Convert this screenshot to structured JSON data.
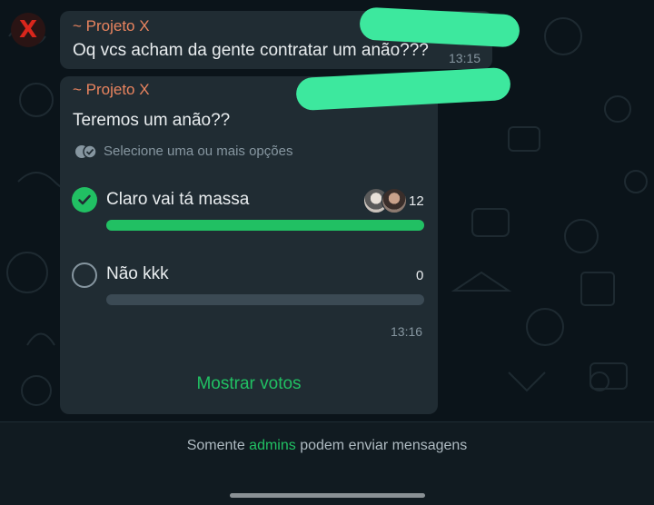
{
  "colors": {
    "accent": "#21c063",
    "sender": "#e9845f",
    "bubble": "#202c33",
    "background": "#0b141a",
    "redaction": "#3de89e"
  },
  "group_avatar": {
    "glyph": "X"
  },
  "messages": [
    {
      "sender": "~ Projeto X",
      "text": "Oq vcs acham da gente contratar um anão???",
      "time": "13:15"
    }
  ],
  "poll": {
    "sender": "~ Projeto X",
    "question": "Teremos um anão??",
    "hint": "Selecione uma ou mais opções",
    "hint_icon": "double-check-icon",
    "options": [
      {
        "label": "Claro vai tá massa",
        "votes": "12",
        "selected": true,
        "fraction": 1.0
      },
      {
        "label": "Não kkk",
        "votes": "0",
        "selected": false,
        "fraction": 0.0
      }
    ],
    "time": "13:16",
    "show_votes_label": "Mostrar votos"
  },
  "footer": {
    "prefix": "Somente ",
    "highlight": "admins",
    "suffix": " podem enviar mensagens"
  }
}
